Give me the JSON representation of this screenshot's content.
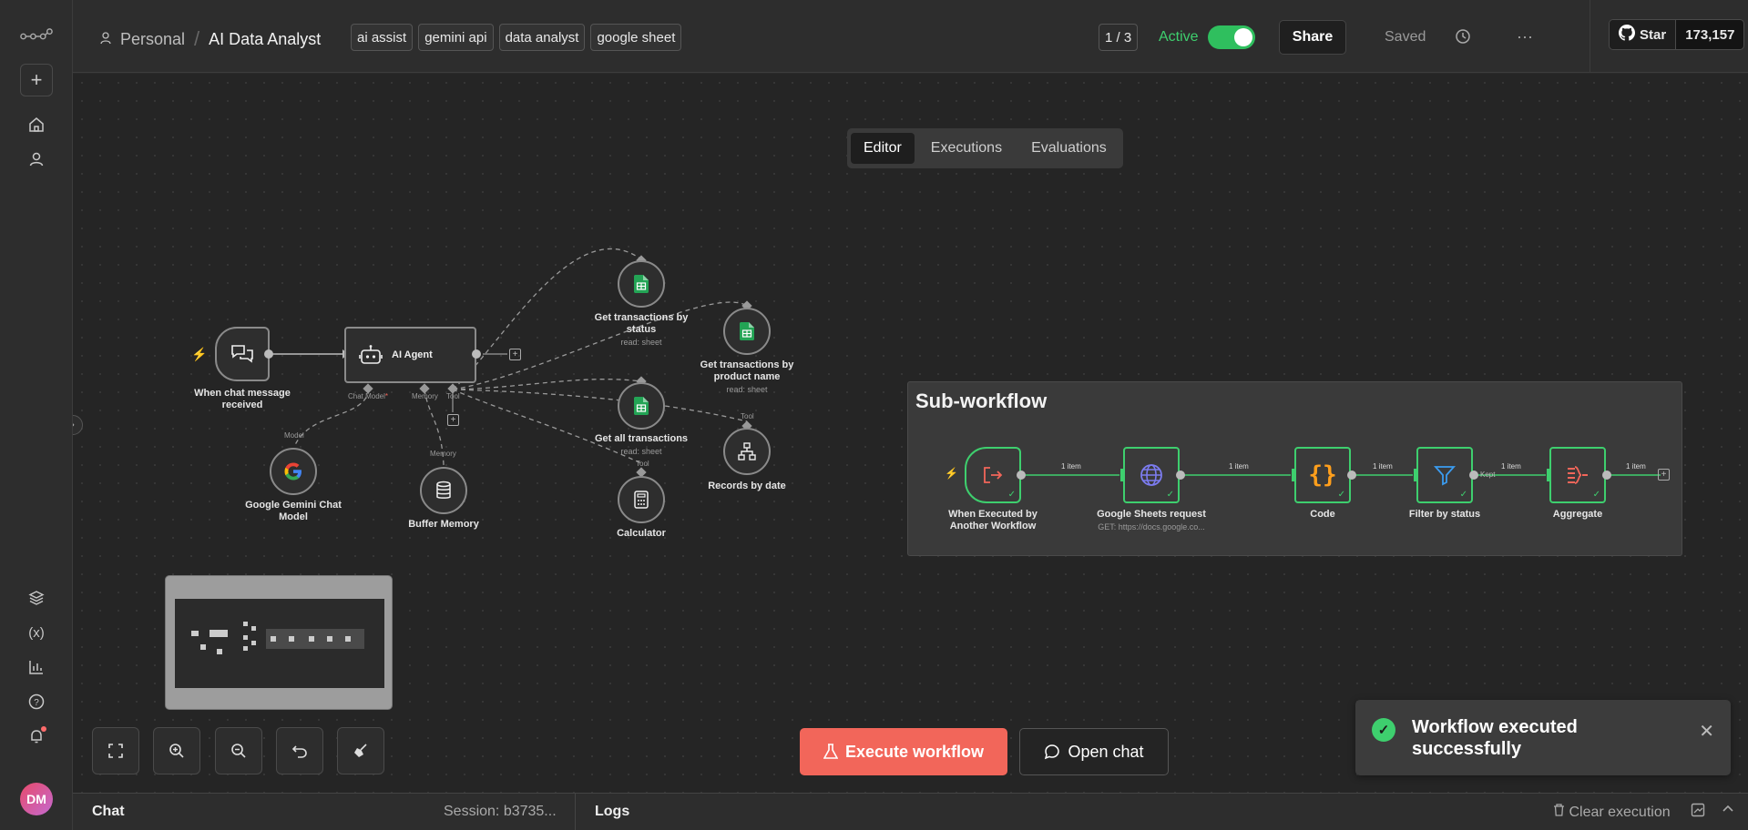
{
  "header": {
    "workspace": "Personal",
    "title": "AI Data Analyst",
    "tags": [
      "ai assist",
      "gemini api",
      "data analyst",
      "google sheet"
    ],
    "pager": "1 / 3",
    "active_label": "Active",
    "share_label": "Share",
    "saved_label": "Saved",
    "github_star_label": "Star",
    "github_star_count": "173,157"
  },
  "tabs": [
    "Editor",
    "Executions",
    "Evaluations"
  ],
  "active_tab": "Editor",
  "nodes": {
    "trigger": "When chat message received",
    "agent": "AI Agent",
    "gemini": "Google Gemini Chat Model",
    "memory": "Buffer Memory",
    "tool_status": "Get transactions by status",
    "tool_status_sub": "read: sheet",
    "tool_product": "Get transactions by product name",
    "tool_product_sub": "read: sheet",
    "tool_all": "Get all transactions",
    "tool_all_sub": "read: sheet",
    "calculator": "Calculator",
    "records": "Records by date",
    "port_chat_model": "Chat Model",
    "port_memory": "Memory",
    "port_tool": "Tool",
    "port_model": "Model",
    "port_memory2": "Memory",
    "port_tool2": "Tool",
    "port_tool3": "Tool"
  },
  "subflow": {
    "title": "Sub-workflow",
    "nodes": [
      {
        "label": "When Executed by Another Workflow",
        "sub": ""
      },
      {
        "label": "Google Sheets request",
        "sub": "GET: https://docs.google.co..."
      },
      {
        "label": "Code",
        "sub": ""
      },
      {
        "label": "Filter by status",
        "sub": ""
      },
      {
        "label": "Aggregate",
        "sub": ""
      }
    ],
    "edges": [
      "1 item",
      "1 item",
      "1 item",
      "1 item",
      "1 item"
    ],
    "kept_label": "Kept"
  },
  "actions": {
    "execute": "Execute workflow",
    "open_chat": "Open chat"
  },
  "toast": {
    "message": "Workflow executed successfully"
  },
  "bottom": {
    "chat": "Chat",
    "session": "Session: b3735...",
    "logs": "Logs",
    "clear": "Clear execution"
  },
  "avatar": "DM",
  "colors": {
    "accent": "#f2665a",
    "active_green": "#3ecf6e",
    "sheets_green": "#23a455"
  }
}
